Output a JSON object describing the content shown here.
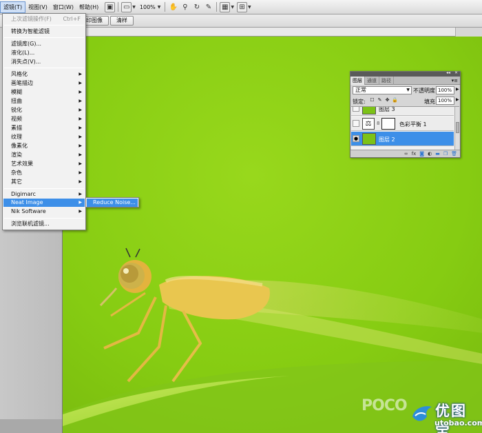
{
  "menubar": {
    "items": [
      {
        "label": "滤镜(T)",
        "active": true
      },
      {
        "label": "视图(V)"
      },
      {
        "label": "窗口(W)"
      },
      {
        "label": "帮助(H)"
      }
    ],
    "zoom": "100%"
  },
  "optionsbar": {
    "buttons": [
      "打印图像",
      "清样"
    ]
  },
  "filter_menu": {
    "items": [
      {
        "label": "上次滤镜操作(F)",
        "shortcut": "Ctrl+F",
        "disabled": true
      },
      {
        "label": "转换为智能滤镜"
      },
      {
        "label": "滤镜库(G)..."
      },
      {
        "label": "液化(L)..."
      },
      {
        "label": "消失点(V)..."
      },
      {
        "label": "风格化",
        "submenu": true
      },
      {
        "label": "画笔描边",
        "submenu": true
      },
      {
        "label": "模糊",
        "submenu": true
      },
      {
        "label": "扭曲",
        "submenu": true
      },
      {
        "label": "锐化",
        "submenu": true
      },
      {
        "label": "视频",
        "submenu": true
      },
      {
        "label": "素描",
        "submenu": true
      },
      {
        "label": "纹理",
        "submenu": true
      },
      {
        "label": "像素化",
        "submenu": true
      },
      {
        "label": "渲染",
        "submenu": true
      },
      {
        "label": "艺术效果",
        "submenu": true
      },
      {
        "label": "杂色",
        "submenu": true
      },
      {
        "label": "其它",
        "submenu": true
      },
      {
        "label": "Digimarc",
        "submenu": true
      },
      {
        "label": "Neat Image",
        "submenu": true,
        "highlighted": true
      },
      {
        "label": "Nik Software",
        "submenu": true
      },
      {
        "label": "浏览联机滤镜..."
      }
    ],
    "submenu_items": [
      {
        "label": "Reduce Noise...",
        "highlighted": true
      }
    ]
  },
  "layers_panel": {
    "tabs": [
      "图层",
      "通道",
      "路径"
    ],
    "blend_mode": "正常",
    "opacity_label": "不透明度:",
    "opacity": "100%",
    "lock_label": "锁定:",
    "fill_label": "填充:",
    "fill": "100%",
    "layers": [
      {
        "name": "图层 3",
        "type": "pixel"
      },
      {
        "name": "色彩平衡 1",
        "type": "adjustment"
      },
      {
        "name": "图层 2",
        "type": "pixel",
        "selected": true
      }
    ]
  },
  "watermark": {
    "poco": "POCO",
    "logo_cn": "优图宝",
    "logo_en": "utobao.com"
  },
  "colors": {
    "highlight": "#3d8fe8",
    "canvas_green": "#8ccd1a"
  }
}
